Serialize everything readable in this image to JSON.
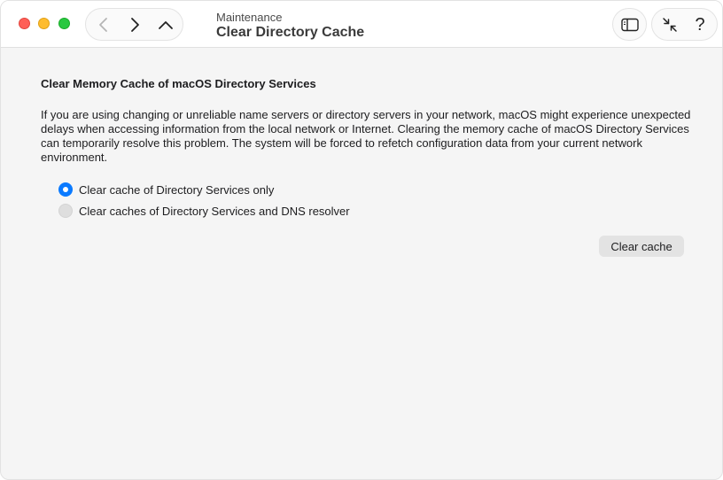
{
  "window": {
    "controls": [
      "close",
      "minimize",
      "zoom"
    ]
  },
  "toolbar": {
    "nav": {
      "back_icon": "chevron-left-icon",
      "forward_icon": "chevron-right-icon",
      "up_icon": "chevron-up-icon"
    },
    "breadcrumb": "Maintenance",
    "title": "Clear Directory Cache",
    "sidebar_icon": "sidebar-icon",
    "collapse_icon": "collapse-arrows-icon",
    "help_label": "?"
  },
  "main": {
    "heading": "Clear Memory Cache of macOS Directory Services",
    "description": "If you are using changing or unreliable name servers or directory servers in your network, macOS might experience unexpected delays when accessing information from the local network or Internet. Clearing the memory cache of macOS Directory Services can temporarily resolve this problem. The system will be forced to refetch configuration data from your current network environment.",
    "options": [
      {
        "label": "Clear cache of Directory Services only",
        "selected": true
      },
      {
        "label": "Clear caches of Directory Services and DNS resolver",
        "selected": false
      }
    ],
    "clear_button": "Clear cache"
  },
  "colors": {
    "accent": "#0a7aff",
    "close": "#ff5f57",
    "minimize": "#febc2e",
    "zoom": "#28c840"
  }
}
